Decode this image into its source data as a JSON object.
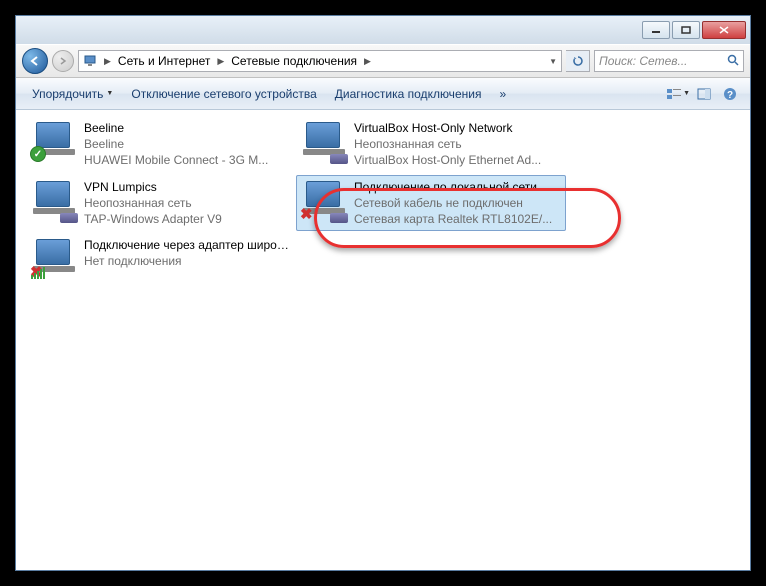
{
  "breadcrumb": {
    "root": "Сеть и Интернет",
    "current": "Сетевые подключения"
  },
  "search": {
    "placeholder": "Поиск: Сетев..."
  },
  "toolbar": {
    "organize": "Упорядочить",
    "disable": "Отключение сетевого устройства",
    "diagnose": "Диагностика подключения",
    "more": "»"
  },
  "connections": [
    {
      "name": "Beeline",
      "status": "Beeline",
      "device": "HUAWEI Mobile Connect - 3G M...",
      "badge": "ok"
    },
    {
      "name": "VirtualBox Host-Only Network",
      "status": "Неопознанная сеть",
      "device": "VirtualBox Host-Only Ethernet Ad...",
      "badge": "cable"
    },
    {
      "name": "VPN Lumpics",
      "status": "Неопознанная сеть",
      "device": "TAP-Windows Adapter V9",
      "badge": "cable"
    },
    {
      "name": "Подключение по локальной сети",
      "status": "Сетевой кабель не подключен",
      "device": "Сетевая карта Realtek RTL8102E/...",
      "badge": "x",
      "selected": true
    },
    {
      "name": "Подключение через адаптер широкополосной мобильной с...",
      "status": "Нет подключения",
      "device": "",
      "badge": "bars-red"
    }
  ]
}
